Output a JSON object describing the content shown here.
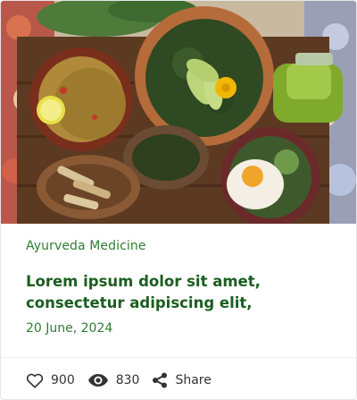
{
  "hero": {
    "alt_icon": "food-photo-image"
  },
  "card": {
    "category": "Ayurveda Medicine",
    "title": "Lorem ipsum dolor sit amet, consectetur adipiscing elit,",
    "date": "20 June, 2024"
  },
  "stats": {
    "likes": "900",
    "views": "830",
    "share_label": "Share"
  },
  "colors": {
    "accent_green": "#2e7d32",
    "title_green": "#1b5e20",
    "icon_color": "#333333"
  }
}
